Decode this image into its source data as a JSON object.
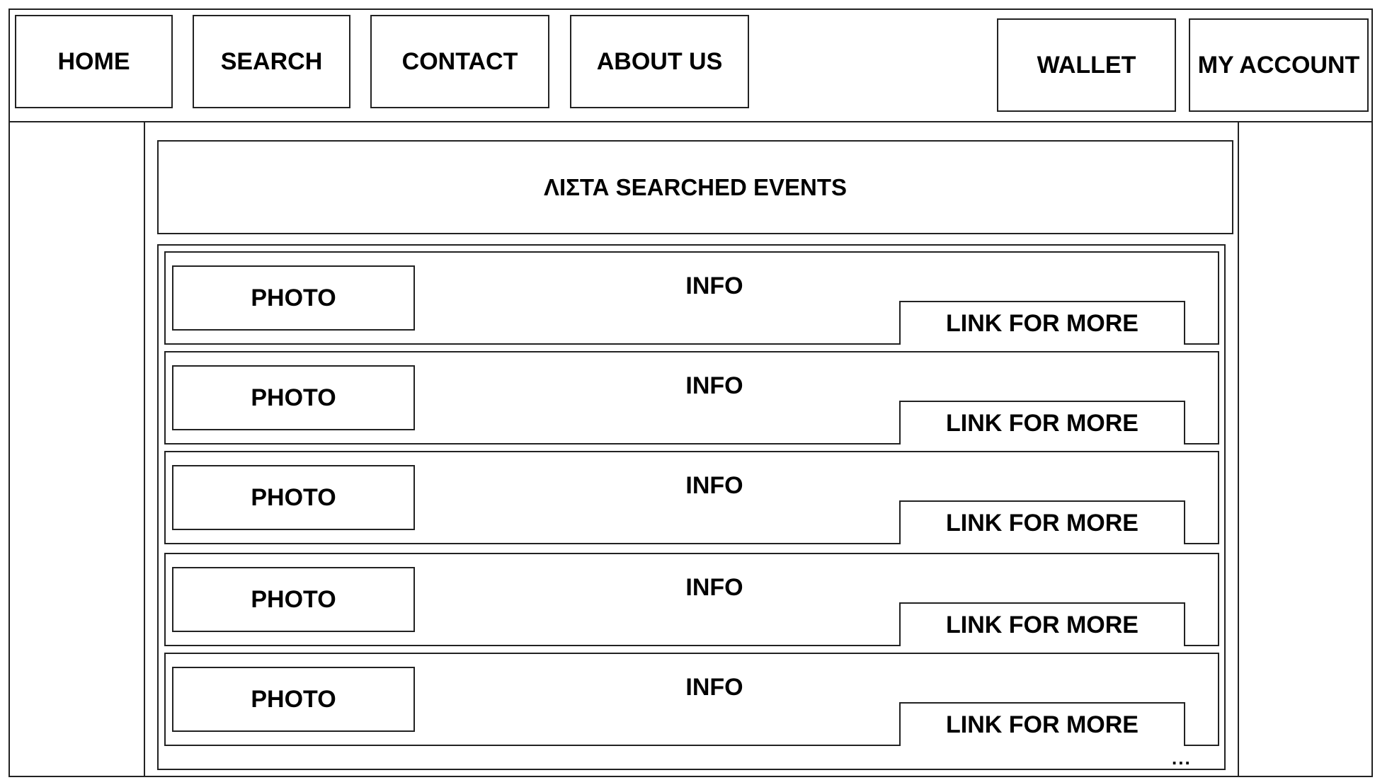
{
  "nav": {
    "home": "HOME",
    "search": "SEARCH",
    "contact": "CONTACT",
    "about_us": "ABOUT US",
    "wallet": "WALLET",
    "my_account": "MY ACCOUNT"
  },
  "main": {
    "title": "ΛΙΣΤΑ SEARCHED EVENTS",
    "events": [
      {
        "photo": "PHOTO",
        "info": "INFO",
        "link": "LINK FOR MORE"
      },
      {
        "photo": "PHOTO",
        "info": "INFO",
        "link": "LINK FOR MORE"
      },
      {
        "photo": "PHOTO",
        "info": "INFO",
        "link": "LINK FOR MORE"
      },
      {
        "photo": "PHOTO",
        "info": "INFO",
        "link": "LINK FOR MORE"
      },
      {
        "photo": "PHOTO",
        "info": "INFO",
        "link": "LINK FOR MORE"
      }
    ],
    "more_indicator": "..."
  }
}
